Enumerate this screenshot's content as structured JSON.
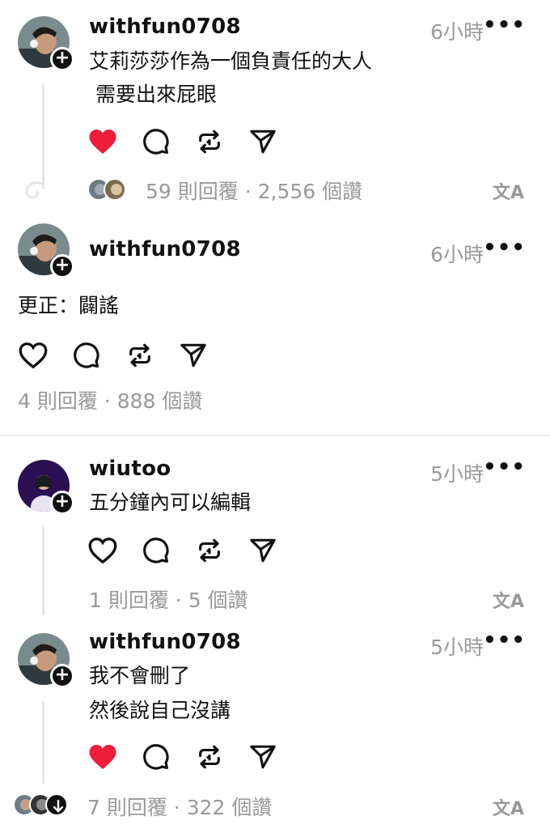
{
  "posts": [
    {
      "username": "withfun0708",
      "time": "6小時",
      "more": "•••",
      "lines": [
        "艾莉莎莎作為一個負責任的大人",
        " 需要出來屁眼"
      ],
      "liked": true,
      "stats": "59 則回覆 · 2,556 個讚",
      "translate": "文A"
    },
    {
      "username": "withfun0708",
      "time": "6小時",
      "more": "•••",
      "lines": [
        "更正：闢謠"
      ],
      "liked": false,
      "stats": "4 則回覆 · 888 個讚"
    },
    {
      "username": "wiutoo",
      "time": "5小時",
      "more": "•••",
      "lines": [
        "五分鐘內可以編輯"
      ],
      "liked": false,
      "stats": "1 則回覆 · 5 個讚",
      "translate": "文A"
    },
    {
      "username": "withfun0708",
      "time": "5小時",
      "more": "•••",
      "lines": [
        "我不會刪了",
        "然後說自己沒講"
      ],
      "liked": true,
      "stats": "7 則回覆 · 322 個讚",
      "translate": "文A"
    }
  ],
  "colors": {
    "like": "#ee1d3a",
    "muted": "#999999",
    "text": "#111111"
  },
  "icons": [
    "heart-icon",
    "comment-icon",
    "repost-icon",
    "share-icon",
    "translate-icon",
    "more-icon",
    "plus-icon"
  ]
}
